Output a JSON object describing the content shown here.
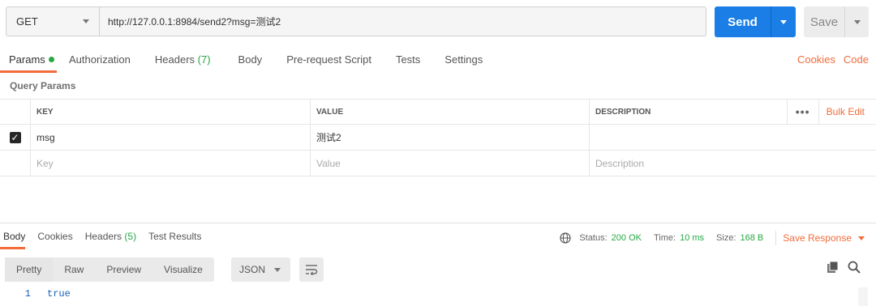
{
  "request": {
    "method": "GET",
    "url": "http://127.0.0.1:8984/send2?msg=测试2",
    "send_label": "Send",
    "save_label": "Save"
  },
  "tabs": [
    {
      "label": "Params",
      "active": true
    },
    {
      "label": "Authorization"
    },
    {
      "label": "Headers",
      "count": "(7)"
    },
    {
      "label": "Body"
    },
    {
      "label": "Pre-request Script"
    },
    {
      "label": "Tests"
    },
    {
      "label": "Settings"
    }
  ],
  "right_links": {
    "cookies": "Cookies",
    "code": "Code"
  },
  "query_params": {
    "title": "Query Params",
    "columns": {
      "key": "KEY",
      "value": "VALUE",
      "description": "DESCRIPTION"
    },
    "bulk_edit": "Bulk Edit",
    "more": "•••",
    "rows": [
      {
        "checked": true,
        "key": "msg",
        "value": "测试2",
        "description": ""
      }
    ],
    "placeholders": {
      "key": "Key",
      "value": "Value",
      "description": "Description"
    }
  },
  "response": {
    "tabs": [
      {
        "label": "Body",
        "active": true
      },
      {
        "label": "Cookies"
      },
      {
        "label": "Headers",
        "count": "(5)"
      },
      {
        "label": "Test Results"
      }
    ],
    "status_label": "Status:",
    "status": "200 OK",
    "time_label": "Time:",
    "time": "10 ms",
    "size_label": "Size:",
    "size": "168 B",
    "save_response": "Save Response",
    "view_modes": [
      "Pretty",
      "Raw",
      "Preview",
      "Visualize"
    ],
    "format": "JSON",
    "body_lines": [
      {
        "n": "1",
        "text": "true"
      }
    ]
  },
  "colors": {
    "accent": "#f26b3a",
    "send": "#1a7ee6",
    "success": "#27a845"
  }
}
